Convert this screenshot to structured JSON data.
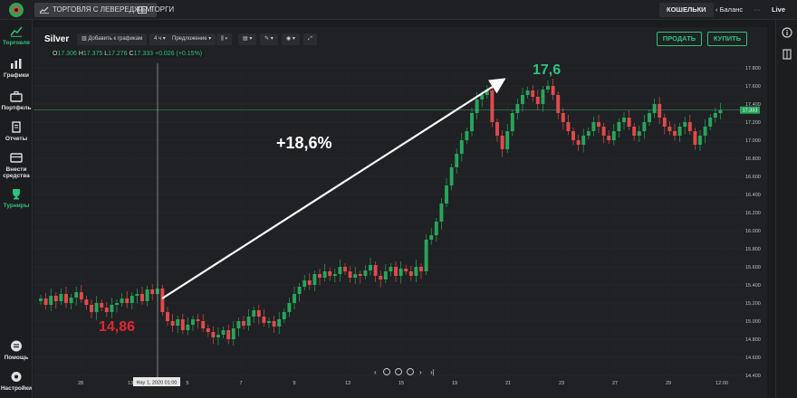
{
  "topbar": {
    "tabs": [
      {
        "label": "ТОРГОВЛЯ С ЛЕВЕРЕДЖЕМ",
        "active": true
      },
      {
        "label": "ТОРГИ",
        "active": false
      }
    ],
    "wallet_label": "КОШЕЛЬКИ",
    "balance_label": "Баланс",
    "more_label": "···",
    "mode_label": "Live"
  },
  "sidebar": {
    "items": [
      {
        "label": "Торговля",
        "icon": "chart-line-icon",
        "active": true
      },
      {
        "label": "Графики",
        "icon": "bar-chart-icon",
        "active": false
      },
      {
        "label": "Портфель",
        "icon": "briefcase-icon",
        "active": false
      },
      {
        "label": "Отчеты",
        "icon": "document-icon",
        "active": false
      },
      {
        "label": "Внести средства",
        "icon": "wallet-icon",
        "active": false
      },
      {
        "label": "Турниры",
        "icon": "trophy-icon",
        "active": true
      }
    ],
    "bottom": [
      {
        "label": "Помощь",
        "icon": "help-icon"
      },
      {
        "label": "Настройки",
        "icon": "gear-icon"
      }
    ]
  },
  "chart_header": {
    "symbol": "Silver",
    "add_to_chart": "Добавить к графикам",
    "timeframe": "4 ч",
    "offer": "Предложение",
    "ohlc": {
      "o_label": "O",
      "o": "17.306",
      "h_label": "H",
      "h": "17.375",
      "l_label": "L",
      "l": "17.276",
      "c_label": "C",
      "c": "17.333",
      "change": "+0.026 (+0.15%)"
    },
    "sell_label": "ПРОДАТЬ",
    "buy_label": "КУПИТЬ"
  },
  "annotations": {
    "gain": "+18,6%",
    "start_price": "14,86",
    "end_price": "17,6",
    "crosshair_date": "Нау 1, 2020  01:00",
    "price_tag": "17.333"
  },
  "colors": {
    "up": "#26a65b",
    "down": "#e04a4a",
    "accent": "#2ec27e",
    "red_label": "#e0282f",
    "bg": "#202124"
  },
  "chart_data": {
    "type": "candlestick",
    "y_ticks": [
      "17.800",
      "17.600",
      "17.400",
      "17.200",
      "17.000",
      "16.800",
      "16.600",
      "16.400",
      "16.200",
      "16.000",
      "15.800",
      "15.600",
      "15.400",
      "15.200",
      "15.000",
      "14.800",
      "14.600",
      "14.400"
    ],
    "x_ticks": [
      "28",
      "13:00",
      "5",
      "7",
      "9",
      "13",
      "15",
      "19",
      "21",
      "23",
      "27",
      "29",
      "12:00"
    ],
    "ylim": [
      14.3,
      17.85
    ],
    "current_price": 17.333,
    "closes": [
      15.25,
      15.18,
      15.28,
      15.22,
      15.3,
      15.2,
      15.26,
      15.32,
      15.24,
      15.18,
      15.1,
      15.2,
      15.15,
      15.1,
      15.18,
      15.2,
      15.25,
      15.2,
      15.28,
      15.3,
      15.22,
      15.35,
      15.3,
      15.36,
      15.1,
      15.0,
      14.95,
      15.02,
      14.9,
      14.96,
      15.02,
      15.0,
      14.92,
      14.88,
      14.82,
      14.85,
      14.9,
      14.8,
      14.92,
      15.0,
      14.95,
      15.05,
      15.12,
      15.05,
      14.98,
      15.0,
      14.94,
      15.02,
      15.1,
      15.2,
      15.3,
      15.38,
      15.45,
      15.4,
      15.52,
      15.48,
      15.55,
      15.5,
      15.52,
      15.6,
      15.55,
      15.48,
      15.52,
      15.5,
      15.56,
      15.62,
      15.5,
      15.46,
      15.55,
      15.6,
      15.5,
      15.58,
      15.55,
      15.5,
      15.6,
      15.55,
      15.9,
      15.95,
      16.1,
      16.3,
      16.5,
      16.7,
      16.85,
      17.0,
      17.1,
      17.3,
      17.45,
      17.5,
      17.55,
      17.2,
      17.05,
      16.9,
      17.1,
      17.3,
      17.4,
      17.5,
      17.55,
      17.48,
      17.4,
      17.56,
      17.6,
      17.5,
      17.3,
      17.2,
      17.1,
      17.0,
      16.95,
      17.05,
      17.1,
      17.2,
      17.15,
      17.05,
      17.0,
      17.1,
      17.2,
      17.25,
      17.15,
      17.05,
      17.1,
      17.2,
      17.3,
      17.4,
      17.25,
      17.15,
      17.1,
      17.05,
      17.15,
      17.2,
      17.1,
      16.95,
      17.05,
      17.15,
      17.25,
      17.3,
      17.333
    ]
  }
}
